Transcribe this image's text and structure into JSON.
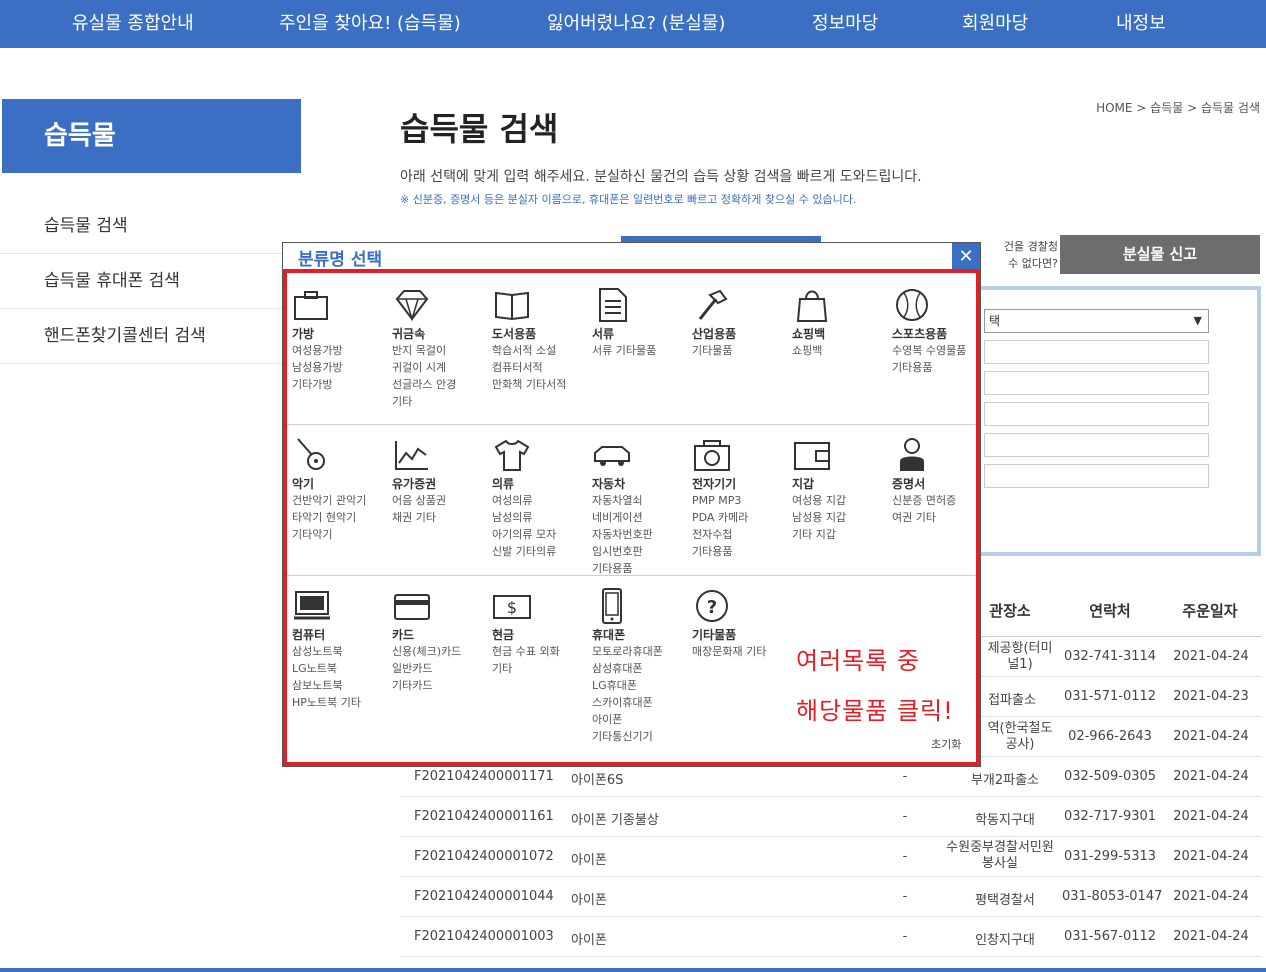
{
  "nav": {
    "items": [
      "유실물 종합안내",
      "주인을 찾아요! (습득물)",
      "잃어버렸나요? (분실물)",
      "정보마당",
      "회원마당",
      "내정보"
    ]
  },
  "sidebar": {
    "title": "습득물",
    "items": [
      "습득물 검색",
      "습득물 휴대폰 검색",
      "핸드폰찾기콜센터 검색"
    ]
  },
  "breadcrumb": "HOME > 습득물 > 습득물 검색",
  "page_title": "습득물 검색",
  "intro": "아래 선택에 맞게 입력 해주세요. 분실하신 물건의 습득 상황 검색을 빠르게 도와드립니다.",
  "note": "※ 신분증, 증명서 등은 분실자 이름으로, 휴대폰은 일련번호로 빠르고 정확하게 찾으실 수 있습니다.",
  "report": {
    "help_line1": "건을 경찰청",
    "help_line2": "수 없다면?",
    "button": "분실물 신고"
  },
  "search": {
    "select_value": "택"
  },
  "table": {
    "headers": [
      "관장소",
      "연락처",
      "주운일자"
    ],
    "rows_partial": [
      {
        "place": "제공항(터미널1)",
        "phone": "032-741-3114",
        "date": "2021-04-24"
      },
      {
        "place": "접파출소",
        "phone": "031-571-0112",
        "date": "2021-04-23"
      },
      {
        "place": "역(한국철도공사)",
        "phone": "02-966-2643",
        "date": "2021-04-24"
      }
    ],
    "rows": [
      {
        "id": "F2021042400001171",
        "name": "아이폰6S",
        "dash": "-",
        "place": "부개2파출소",
        "phone": "032-509-0305",
        "date": "2021-04-24"
      },
      {
        "id": "F2021042400001161",
        "name": "아이폰 기종불상",
        "dash": "-",
        "place": "학동지구대",
        "phone": "032-717-9301",
        "date": "2021-04-24"
      },
      {
        "id": "F2021042400001072",
        "name": "아이폰",
        "dash": "-",
        "place": "수원중부경찰서민원봉사실",
        "phone": "031-299-5313",
        "date": "2021-04-24"
      },
      {
        "id": "F2021042400001044",
        "name": "아이폰",
        "dash": "-",
        "place": "평택경찰서",
        "phone": "031-8053-0147",
        "date": "2021-04-24"
      },
      {
        "id": "F2021042400001003",
        "name": "아이폰",
        "dash": "-",
        "place": "인창지구대",
        "phone": "031-567-0112",
        "date": "2021-04-24"
      }
    ]
  },
  "modal": {
    "title": "분류명 선택",
    "close": "✕",
    "reset": "초기화",
    "hint_line1": "여러목록 중",
    "hint_line2": "해당물품 클릭!",
    "categories": [
      {
        "icon": "bag-icon",
        "name": "가방",
        "sub": [
          "여성용가방",
          "남성용가방",
          "기타가방"
        ]
      },
      {
        "icon": "diamond-icon",
        "name": "귀금속",
        "sub": [
          "반지 목걸이",
          "귀걸이 시계",
          "선글라스 안경",
          "기타"
        ]
      },
      {
        "icon": "book-icon",
        "name": "도서용품",
        "sub": [
          "학습서적 소설",
          "컴퓨터서적",
          "만화책 기타서적"
        ]
      },
      {
        "icon": "document-icon",
        "name": "서류",
        "sub": [
          "서류 기타물품"
        ]
      },
      {
        "icon": "hammer-icon",
        "name": "산업용품",
        "sub": [
          "기타물품"
        ]
      },
      {
        "icon": "shopping-bag-icon",
        "name": "쇼핑백",
        "sub": [
          "쇼핑백"
        ]
      },
      {
        "icon": "baseball-icon",
        "name": "스포츠용품",
        "sub": [
          "수영복 수영물품",
          "기타용품"
        ]
      },
      {
        "icon": "guitar-icon",
        "name": "악기",
        "sub": [
          "건반악기 관악기",
          "타악기 현악기",
          "기타악기"
        ]
      },
      {
        "icon": "chart-icon",
        "name": "유가증권",
        "sub": [
          "어음 상품권",
          "채권 기타"
        ]
      },
      {
        "icon": "shirt-icon",
        "name": "의류",
        "sub": [
          "여성의류",
          "남성의류",
          "아기의류 모자",
          "신발 기타의류"
        ]
      },
      {
        "icon": "car-icon",
        "name": "자동차",
        "sub": [
          "자동차열쇠",
          "네비게이션",
          "자동차번호판",
          "임시번호판",
          "기타용품"
        ]
      },
      {
        "icon": "camera-icon",
        "name": "전자기기",
        "sub": [
          "PMP MP3",
          "PDA 카메라",
          "전자수첩",
          "기타용품"
        ]
      },
      {
        "icon": "wallet-icon",
        "name": "지갑",
        "sub": [
          "여성용 지갑",
          "남성용 지갑",
          "기타 지갑"
        ]
      },
      {
        "icon": "person-id-icon",
        "name": "증명서",
        "sub": [
          "신분증 면허증",
          "여권 기타"
        ]
      },
      {
        "icon": "laptop-icon",
        "name": "컴퓨터",
        "sub": [
          "삼성노트북",
          "LG노트북",
          "삼보노트북",
          "HP노트북 기타"
        ]
      },
      {
        "icon": "card-icon",
        "name": "카드",
        "sub": [
          "신용(체크)카드",
          "일반카드",
          "기타카드"
        ]
      },
      {
        "icon": "cash-icon",
        "name": "현금",
        "sub": [
          "현금 수표 외화",
          "기타"
        ]
      },
      {
        "icon": "phone-icon",
        "name": "휴대폰",
        "sub": [
          "모토로라휴대폰",
          "삼성휴대폰",
          "LG휴대폰",
          "스카이휴대폰",
          "아이폰",
          "기타통신기기"
        ]
      },
      {
        "icon": "question-icon",
        "name": "기타물품",
        "sub": [
          "매장문화재 기타"
        ]
      }
    ]
  }
}
